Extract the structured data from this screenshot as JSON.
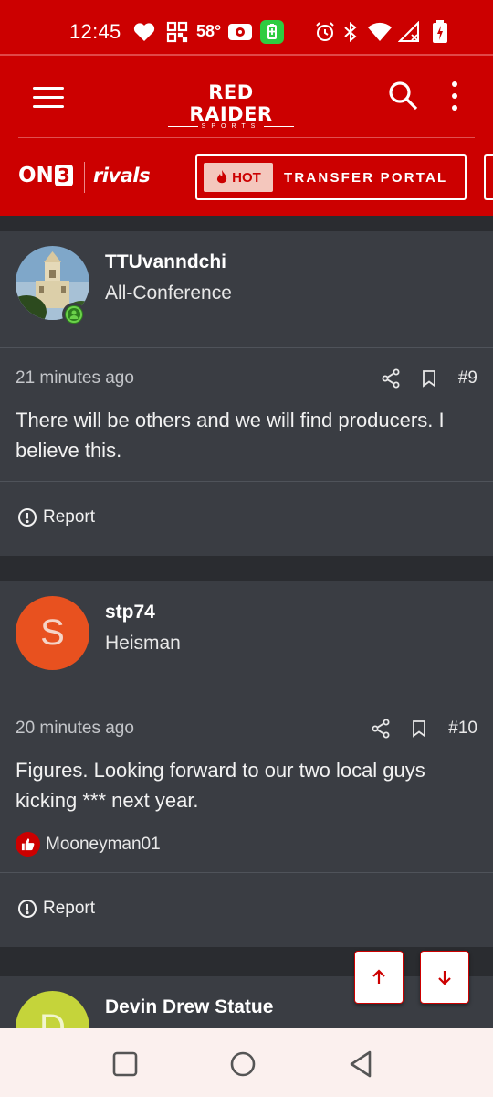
{
  "status_bar": {
    "time": "12:45",
    "temperature": "58°",
    "icons": [
      "heart-icon",
      "grid-icon",
      "temperature",
      "radio-icon",
      "battery-saver-icon",
      "alarm-icon",
      "bluetooth-icon",
      "wifi-icon",
      "signal-icon",
      "battery-icon"
    ]
  },
  "header": {
    "logo_main": "RED RAIDER",
    "logo_sub": "SPORTS",
    "on3_text": "ON",
    "on3_num": "3",
    "rivals_text": "rivals",
    "hot_label": "HOT",
    "portal_label": "TRANSFER PORTAL"
  },
  "posts": [
    {
      "username": "TTUvanndchi",
      "user_title": "All-Conference",
      "avatar": "photo",
      "online": true,
      "timestamp": "21 minutes ago",
      "post_number": "#9",
      "body": "There will be others and we will find producers. I believe this.",
      "report_label": "Report"
    },
    {
      "username": "stp74",
      "user_title": "Heisman",
      "avatar_letter": "S",
      "avatar_color": "#e8511f",
      "timestamp": "20 minutes ago",
      "post_number": "#10",
      "body": "Figures. Looking forward to our two local guys kicking *** next year.",
      "liked_by": "Mooneyman01",
      "report_label": "Report"
    },
    {
      "username": "Devin Drew Statue",
      "avatar_letter": "D",
      "avatar_color": "#c5d43a"
    }
  ],
  "colors": {
    "brand_red": "#cc0000",
    "post_bg": "#3a3d43",
    "page_bg": "#2a2c30"
  }
}
